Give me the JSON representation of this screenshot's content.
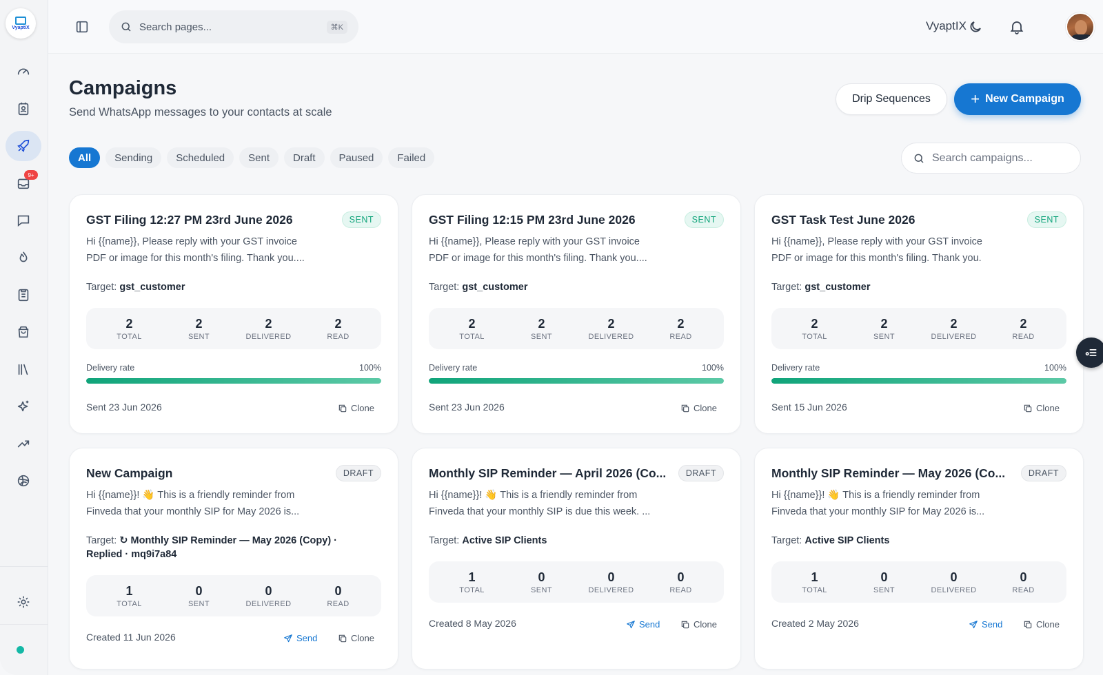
{
  "brand": {
    "logo_text": "VyaptiX",
    "name": "VyaptIX"
  },
  "topbar": {
    "search_placeholder": "Search pages...",
    "shortcut": "⌘K"
  },
  "sidebar": {
    "notification_badge": "9+",
    "items": [
      {
        "name": "dashboard",
        "icon": "gauge-icon"
      },
      {
        "name": "contacts",
        "icon": "contact-card-icon"
      },
      {
        "name": "campaigns",
        "icon": "rocket-icon",
        "active": true
      },
      {
        "name": "inbox",
        "icon": "inbox-icon"
      },
      {
        "name": "chats",
        "icon": "chat-icon"
      },
      {
        "name": "hot-leads",
        "icon": "flame-icon"
      },
      {
        "name": "tasks",
        "icon": "clipboard-icon"
      },
      {
        "name": "orders",
        "icon": "shopping-bag-icon"
      },
      {
        "name": "library",
        "icon": "library-icon"
      },
      {
        "name": "ai",
        "icon": "sparkles-icon"
      },
      {
        "name": "analytics",
        "icon": "trending-up-icon"
      },
      {
        "name": "integrations",
        "icon": "globe-icon"
      },
      {
        "name": "settings",
        "icon": "gear-icon"
      }
    ]
  },
  "header": {
    "title": "Campaigns",
    "subtitle": "Send WhatsApp messages to your contacts at scale",
    "drip_label": "Drip Sequences",
    "new_label": "New Campaign"
  },
  "filters": {
    "tabs": [
      "All",
      "Sending",
      "Scheduled",
      "Sent",
      "Draft",
      "Paused",
      "Failed"
    ],
    "active": "All",
    "search_placeholder": "Search campaigns..."
  },
  "labels": {
    "target": "Target:",
    "total": "TOTAL",
    "sent": "SENT",
    "delivered": "DELIVERED",
    "read": "READ",
    "delivery_rate": "Delivery rate",
    "clone": "Clone",
    "send": "Send"
  },
  "colors": {
    "accent": "#1677d2",
    "success": "#10a47a",
    "badge": "#ef4444"
  },
  "campaigns": [
    {
      "title": "GST Filing 12:27 PM 23rd June 2026",
      "status": "SENT",
      "message_l1": "Hi {{name}}, Please reply with your GST invoice",
      "message_l2": "PDF or image for this month's filing. Thank you....",
      "target": "gst_customer",
      "total": "2",
      "sent": "2",
      "delivered": "2",
      "read": "2",
      "delivery_rate": "100%",
      "delivery_fraction": 1.0,
      "date": "Sent 23 Jun 2026"
    },
    {
      "title": "GST Filing 12:15 PM 23rd June 2026",
      "status": "SENT",
      "message_l1": "Hi {{name}}, Please reply with your GST invoice",
      "message_l2": "PDF or image for this month's filing. Thank you....",
      "target": "gst_customer",
      "total": "2",
      "sent": "2",
      "delivered": "2",
      "read": "2",
      "delivery_rate": "100%",
      "delivery_fraction": 1.0,
      "date": "Sent 23 Jun 2026"
    },
    {
      "title": "GST Task Test June 2026",
      "status": "SENT",
      "message_l1": "Hi {{name}}, Please reply with your GST invoice",
      "message_l2": "PDF or image for this month's filing. Thank you.",
      "target": "gst_customer",
      "total": "2",
      "sent": "2",
      "delivered": "2",
      "read": "2",
      "delivery_rate": "100%",
      "delivery_fraction": 1.0,
      "date": "Sent 15 Jun 2026"
    },
    {
      "title": "New Campaign",
      "status": "DRAFT",
      "message_l1": "Hi {{name}}! 👋 This is a friendly reminder from",
      "message_l2": "Finveda that your monthly SIP for May 2026 is...",
      "target_l1": "↻ Monthly SIP Reminder — May 2026 (Copy) ·",
      "target_l2": "Replied · mq9i7a84",
      "total": "1",
      "sent": "0",
      "delivered": "0",
      "read": "0",
      "date": "Created 11 Jun 2026"
    },
    {
      "title": "Monthly SIP Reminder — April 2026 (Co...",
      "status": "DRAFT",
      "message_l1": "Hi {{name}}! 👋 This is a friendly reminder from",
      "message_l2": "Finveda that your monthly SIP is due this week. ...",
      "target": "Active SIP Clients",
      "total": "1",
      "sent": "0",
      "delivered": "0",
      "read": "0",
      "date": "Created 8 May 2026"
    },
    {
      "title": "Monthly SIP Reminder — May 2026 (Co...",
      "status": "DRAFT",
      "message_l1": "Hi {{name}}! 👋 This is a friendly reminder from",
      "message_l2": "Finveda that your monthly SIP for May 2026 is...",
      "target": "Active SIP Clients",
      "total": "1",
      "sent": "0",
      "delivered": "0",
      "read": "0",
      "date": "Created 2 May 2026"
    }
  ]
}
